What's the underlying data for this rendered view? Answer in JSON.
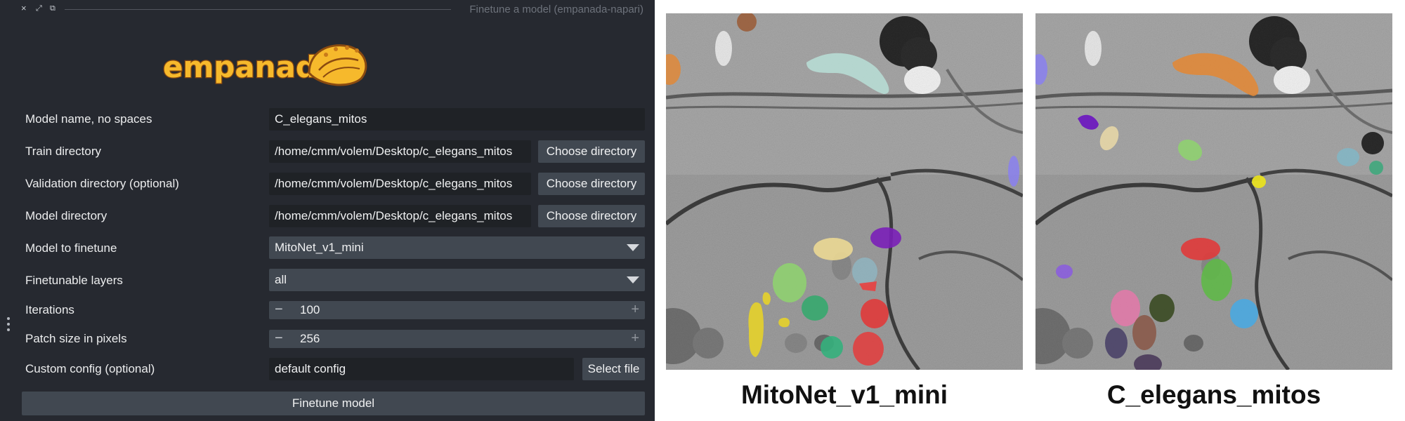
{
  "window": {
    "title": "Finetune a model (empanada-napari)",
    "controls": [
      "×",
      "⤢",
      "⧉"
    ]
  },
  "logo": {
    "text": "empanada"
  },
  "form": {
    "model_name": {
      "label": "Model name, no spaces",
      "value": "C_elegans_mitos"
    },
    "train_dir": {
      "label": "Train directory",
      "value": "/home/cmm/volem/Desktop/c_elegans_mitos",
      "button": "Choose directory"
    },
    "val_dir": {
      "label": "Validation directory (optional)",
      "value": "/home/cmm/volem/Desktop/c_elegans_mitos",
      "button": "Choose directory"
    },
    "model_dir": {
      "label": "Model directory",
      "value": "/home/cmm/volem/Desktop/c_elegans_mitos",
      "button": "Choose directory"
    },
    "model_to_finetune": {
      "label": "Model to finetune",
      "value": "MitoNet_v1_mini"
    },
    "finetunable_layers": {
      "label": "Finetunable layers",
      "value": "all"
    },
    "iterations": {
      "label": "Iterations",
      "value": "100",
      "minus": "−",
      "plus": "+"
    },
    "patch_size": {
      "label": "Patch size in pixels",
      "value": "256",
      "minus": "−",
      "plus": "+"
    },
    "custom_config": {
      "label": "Custom config (optional)",
      "value": "default config",
      "button": "Select file"
    },
    "submit": "Finetune model"
  },
  "figures": [
    {
      "caption": "MitoNet_v1_mini"
    },
    {
      "caption": "C_elegans_mitos"
    }
  ],
  "colors": {
    "panel_bg": "#262930",
    "field_bg": "#414851",
    "logo_fill": "#f6b92c",
    "logo_outline": "#8a4a10"
  }
}
